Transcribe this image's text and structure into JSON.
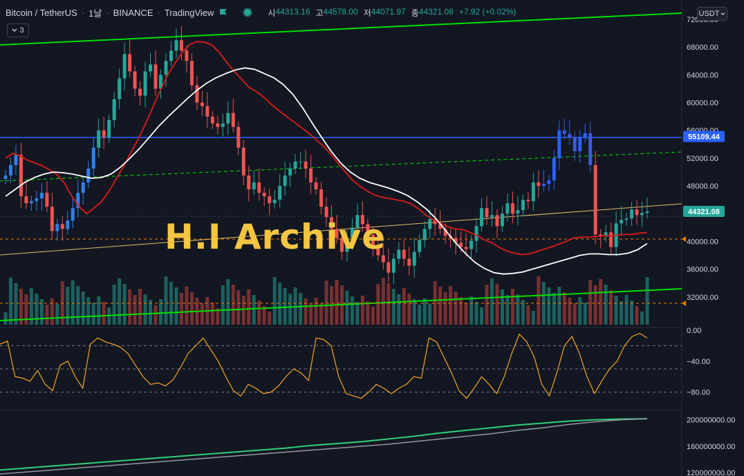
{
  "legend": {
    "pair": "Bitcoin / TetherUS",
    "interval": "1날",
    "exchange": "BINANCE",
    "source": "TradingView",
    "open_label": "시",
    "open": "44313.16",
    "high_label": "고",
    "high": "44578.00",
    "low_label": "저",
    "low": "44071.97",
    "close_label": "종",
    "close": "44321.08",
    "change": "+7.92 (+0.02%)",
    "indicator_count": "3"
  },
  "currency_label": "USDT",
  "watermark": "H.I Archive",
  "colors": {
    "background": "#131722",
    "up": "#26a69a",
    "down": "#ef5350",
    "trend_green": "#00e000",
    "resistance": "#2962ff",
    "ma_red": "#e01b1b",
    "ma_white": "#ffffff",
    "oscillator": "#f5a623",
    "obv": "#2fd07a",
    "label_price": "#26a69a",
    "label_level": "#2962ff"
  },
  "chart_data": [
    {
      "type": "candlestick",
      "panel": "price",
      "title": "Bitcoin / TetherUS",
      "ylim": [
        28000,
        72000
      ],
      "y_ticks": [
        "72000.00",
        "68000.00",
        "64000.00",
        "60000.00",
        "56000.00",
        "52000.00",
        "48000.00",
        "44000.00",
        "40000.00",
        "36000.00",
        "32000.00"
      ],
      "last_price": "44321.08",
      "resistance_level": "55109.44",
      "close_series": [
        49500,
        51000,
        52500,
        46500,
        45500,
        45800,
        46200,
        47000,
        45000,
        41500,
        42500,
        41800,
        43000,
        44800,
        47000,
        48500,
        50500,
        53500,
        56000,
        55000,
        57500,
        60500,
        63500,
        67000,
        64500,
        62000,
        61000,
        64500,
        65500,
        62000,
        64000,
        66000,
        67500,
        69000,
        67500,
        66000,
        62500,
        60000,
        59500,
        58000,
        57000,
        56500,
        57000,
        58500,
        56500,
        53500,
        49500,
        47500,
        48500,
        47000,
        46500,
        45500,
        46000,
        48000,
        49500,
        50500,
        51500,
        51500,
        50500,
        48500,
        47500,
        45000,
        43500,
        41800,
        40500,
        38500,
        40500,
        42000,
        43800,
        42500,
        41000,
        39500,
        38000,
        37000,
        35500,
        37500,
        38800,
        37500,
        36500,
        38500,
        40200,
        41800,
        43200,
        42500,
        41800,
        40800,
        40500,
        39800,
        39200,
        38900,
        40100,
        42200,
        44800,
        43500,
        43800,
        42200,
        44000,
        45500,
        44000,
        44500,
        46000,
        45800,
        48500,
        48000,
        48300,
        48800,
        52000,
        56000,
        55500,
        55000,
        53000,
        55000,
        55600,
        51000,
        41000,
        40700,
        41300,
        39200,
        42600,
        43100,
        43300,
        44600,
        43800,
        44100,
        44321
      ],
      "ma_red_series": [
        52000,
        52700,
        52300,
        51700,
        51300,
        50900,
        50300,
        49600,
        48400,
        46500,
        45000,
        44000,
        44800,
        45700,
        47200,
        49000,
        50800,
        52800,
        54800,
        57000,
        59400,
        61800,
        64000,
        65700,
        67300,
        68400,
        68800,
        68700,
        68300,
        67200,
        65800,
        64500,
        63400,
        62200,
        61600,
        60800,
        59800,
        58900,
        58100,
        57300,
        56500,
        55700,
        54800,
        53800,
        52700,
        51400,
        50100,
        48900,
        48000,
        47300,
        46700,
        46400,
        46200,
        46000,
        45800,
        45400,
        44700,
        43800,
        43100,
        42600,
        42100,
        41800,
        41700,
        41300,
        40800,
        40200,
        39800,
        39100,
        38600,
        38300,
        38100,
        38200,
        38500,
        38900,
        39200,
        39600,
        40000,
        40500,
        40600,
        40600,
        40700,
        40800,
        40800,
        40900,
        41000,
        41000,
        41200,
        41300
      ],
      "ma_white_series": [
        46500,
        47500,
        48500,
        49200,
        49700,
        50000,
        49900,
        49700,
        49400,
        49100,
        49200,
        49700,
        50700,
        52000,
        53400,
        55000,
        56600,
        58000,
        59300,
        60600,
        61800,
        62800,
        63600,
        64200,
        64700,
        65000,
        64800,
        64200,
        63600,
        62600,
        61200,
        59300,
        57100,
        55000,
        53000,
        51300,
        50000,
        49100,
        48500,
        48100,
        47700,
        47200,
        46600,
        45700,
        44600,
        43200,
        41500,
        39800,
        38300,
        37000,
        36100,
        35500,
        35300,
        35400,
        35600,
        36000,
        36400,
        36800,
        37200,
        37600,
        38000,
        38200,
        38200,
        38100,
        38100,
        38300,
        38800,
        39700
      ]
    },
    {
      "type": "line",
      "panel": "oscillator",
      "ylim": [
        -100,
        0
      ],
      "y_ticks": [
        "0.00",
        "−40.00",
        "−80.00"
      ],
      "reference_levels": [
        -20,
        -50,
        -80
      ],
      "series": [
        {
          "values": [
            -18,
            -14,
            -60,
            -62,
            -66,
            -52,
            -70,
            -78,
            -45,
            -40,
            -60,
            -75,
            -18,
            -10,
            -15,
            -18,
            -22,
            -30,
            -45,
            -60,
            -70,
            -68,
            -72,
            -64,
            -48,
            -30,
            -20,
            -10,
            -25,
            -40,
            -60,
            -78,
            -85,
            -70,
            -75,
            -82,
            -80,
            -72,
            -60,
            -50,
            -55,
            -65,
            -10,
            -12,
            -20,
            -60,
            -82,
            -85,
            -88,
            -80,
            -70,
            -75,
            -82,
            -75,
            -70,
            -60,
            -62,
            -10,
            -15,
            -35,
            -55,
            -78,
            -88,
            -75,
            -60,
            -70,
            -82,
            -60,
            -30,
            -5,
            -15,
            -35,
            -70,
            -85,
            -55,
            -20,
            -8,
            -30,
            -60,
            -82,
            -65,
            -50,
            -40,
            -20,
            -8,
            -4,
            -10
          ]
        }
      ]
    },
    {
      "type": "line",
      "panel": "volume-flow",
      "ylim": [
        115000000,
        210000000
      ],
      "y_ticks": [
        "200000000.00",
        "160000000.00",
        "120000000.00"
      ],
      "series": [
        {
          "values": [
            124000000,
            127000000,
            130000000,
            133000000,
            136000000,
            139000000,
            142000000,
            145000000,
            148000000,
            151000000,
            154000000,
            157000000,
            161000000,
            164000000,
            167000000,
            171000000,
            175000000,
            180000000,
            184000000,
            188000000,
            192000000,
            195000000,
            198000000,
            200000000,
            201000000,
            201500000
          ]
        },
        {
          "values": [
            118000000,
            121000000,
            124000000,
            127000000,
            130000000,
            133000000,
            136000000,
            139000000,
            142000000,
            145000000,
            148000000,
            151000000,
            154000000,
            157000000,
            160000000,
            163000000,
            167000000,
            171000000,
            175000000,
            179000000,
            184000000,
            188000000,
            193000000,
            197000000,
            200000000,
            201500000
          ]
        }
      ]
    }
  ]
}
